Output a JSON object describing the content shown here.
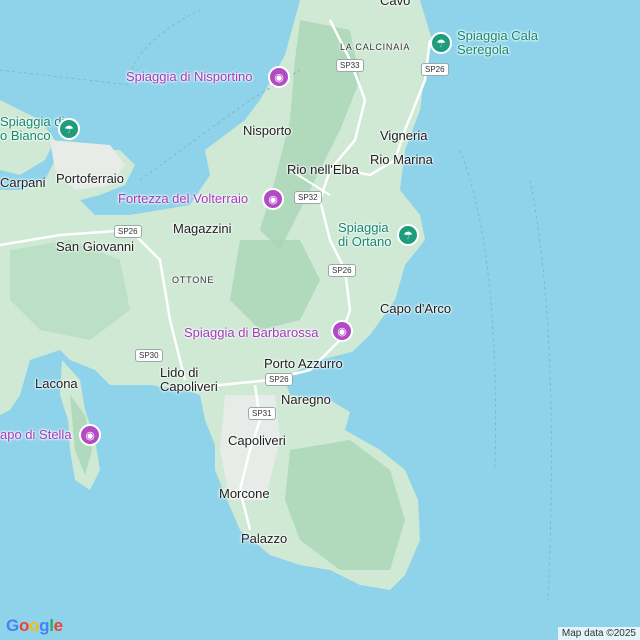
{
  "map": {
    "places": [
      {
        "id": "cavo",
        "text": "Cavo"
      },
      {
        "id": "la-calcinaia",
        "text": "LA CALCINAIA"
      },
      {
        "id": "nisporto",
        "text": "Nisporto"
      },
      {
        "id": "vigneria",
        "text": "Vigneria"
      },
      {
        "id": "rio-nell-elba",
        "text": "Rio nell'Elba"
      },
      {
        "id": "rio-marina",
        "text": "Rio Marina"
      },
      {
        "id": "carpani",
        "text": "Carpani"
      },
      {
        "id": "portoferraio",
        "text": "Portoferraio"
      },
      {
        "id": "magazzini",
        "text": "Magazzini"
      },
      {
        "id": "san-giovanni",
        "text": "San Giovanni"
      },
      {
        "id": "ottone",
        "text": "OTTONE"
      },
      {
        "id": "capo-d-arco",
        "text": "Capo d'Arco"
      },
      {
        "id": "porto-azzurro",
        "text": "Porto Azzurro"
      },
      {
        "id": "lido-di-capoliveri",
        "text": "Lido di\nCapoliveri"
      },
      {
        "id": "lacona",
        "text": "Lacona"
      },
      {
        "id": "naregno",
        "text": "Naregno"
      },
      {
        "id": "capoliveri",
        "text": "Capoliveri"
      },
      {
        "id": "morcone",
        "text": "Morcone"
      },
      {
        "id": "palazzo",
        "text": "Palazzo"
      }
    ],
    "pois": [
      {
        "id": "spiaggia-di-nisportino",
        "text": "Spiaggia di Nisportino",
        "icon": "camera-icon"
      },
      {
        "id": "fortezza-del-volterraio",
        "text": "Fortezza del Volterraio",
        "icon": "camera-icon"
      },
      {
        "id": "spiaggia-di-barbarossa",
        "text": "Spiaggia di Barbarossa",
        "icon": "camera-icon"
      },
      {
        "id": "capo-di-stella",
        "text": "apo di Stella",
        "icon": "camera-icon"
      }
    ],
    "beaches": [
      {
        "id": "spiaggia-cala-seregola",
        "text": "Spiaggia Cala\nSeregola",
        "icon": "beach-umbrella-icon"
      },
      {
        "id": "spiaggia-di-ortano",
        "text": "Spiaggia\ndi Ortano",
        "icon": "beach-umbrella-icon"
      },
      {
        "id": "spiaggia-bianco",
        "text": "Spiaggia di\no Bianco",
        "icon": "beach-umbrella-icon"
      }
    ],
    "roads": [
      {
        "id": "sp33",
        "text": "SP33"
      },
      {
        "id": "sp26-north",
        "text": "SP26"
      },
      {
        "id": "sp32",
        "text": "SP32"
      },
      {
        "id": "sp26-ortano",
        "text": "SP26"
      },
      {
        "id": "sp26-west",
        "text": "SP26"
      },
      {
        "id": "sp30",
        "text": "SP30"
      },
      {
        "id": "sp26-porto",
        "text": "SP26"
      },
      {
        "id": "sp31",
        "text": "SP31"
      }
    ]
  },
  "footer": {
    "logo": "Google",
    "attribution": "Map data ©2025"
  },
  "colors": {
    "sea": "#8fd3ea",
    "land": "#cfe9d5",
    "terrain": "#a9d5b4",
    "poi": "#a43bb8",
    "beach": "#138a6e"
  }
}
